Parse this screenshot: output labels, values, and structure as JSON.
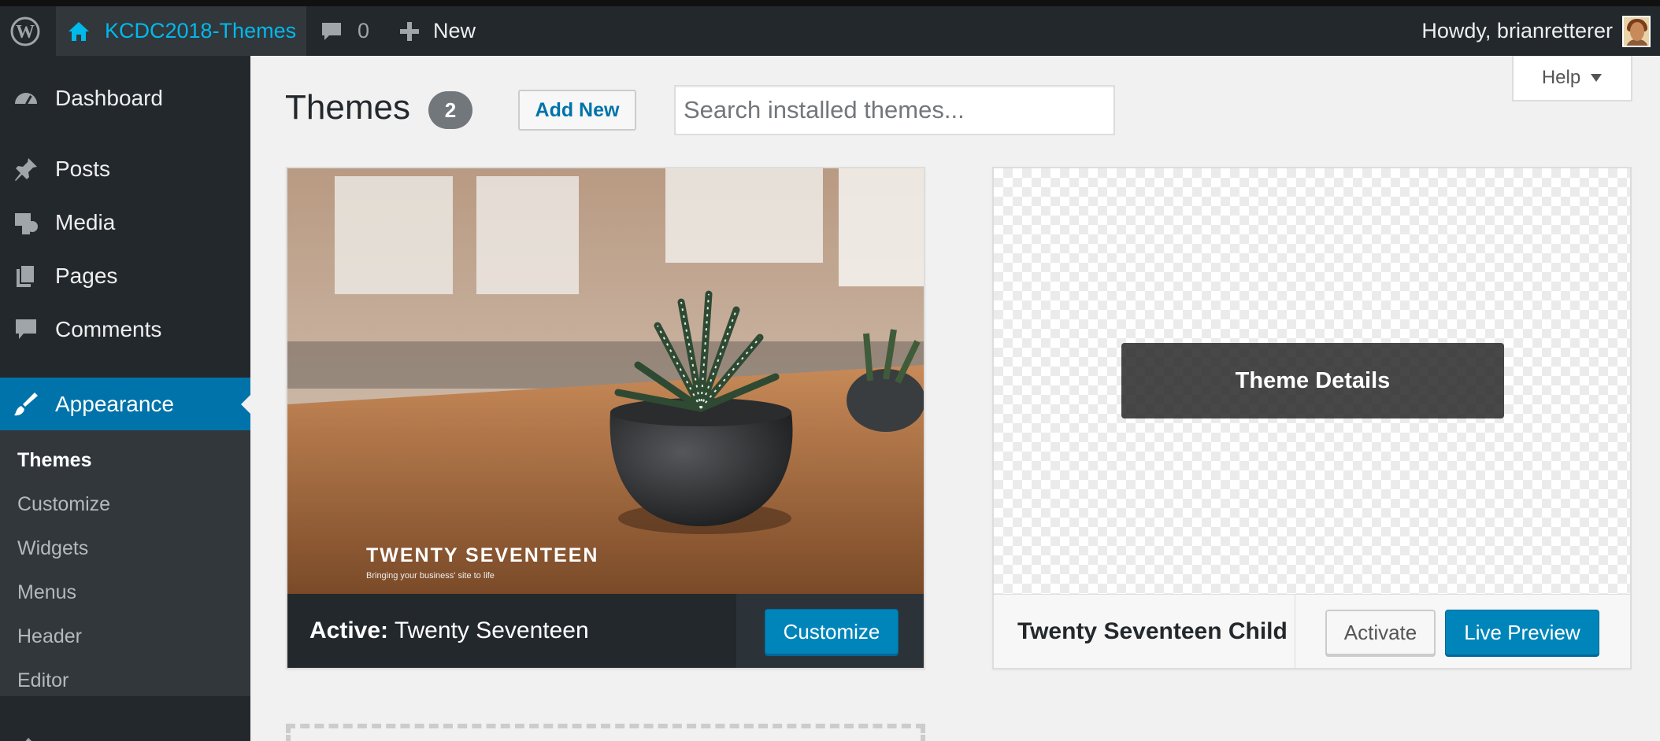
{
  "adminbar": {
    "wp_logo_icon": "wordpress-logo-icon",
    "site_name": "KCDC2018-Themes",
    "site_icon": "home-icon",
    "comments_count": "0",
    "comments_icon": "comment-bubble-icon",
    "new_label": "New",
    "new_icon": "plus-icon",
    "howdy": "Howdy, brianretterer"
  },
  "sidebar": {
    "items": [
      {
        "label": "Dashboard",
        "icon": "dashboard-icon"
      },
      {
        "label": "Posts",
        "icon": "pin-icon"
      },
      {
        "label": "Media",
        "icon": "media-icon"
      },
      {
        "label": "Pages",
        "icon": "pages-icon"
      },
      {
        "label": "Comments",
        "icon": "comment-icon"
      },
      {
        "label": "Appearance",
        "icon": "paintbrush-icon",
        "current": true
      }
    ],
    "submenu": [
      "Themes",
      "Customize",
      "Widgets",
      "Menus",
      "Header",
      "Editor"
    ],
    "accent_color": "#0073aa"
  },
  "main": {
    "title": "Themes",
    "count": "2",
    "add_new": "Add New",
    "search_placeholder": "Search installed themes...",
    "help": "Help"
  },
  "themes": [
    {
      "screenshot_title": "TWENTY SEVENTEEN",
      "screenshot_tagline": "Bringing your business' site to life",
      "active_label": "Active:",
      "name": "Twenty Seventeen",
      "primary_action": "Customize"
    },
    {
      "overlay": "Theme Details",
      "name": "Twenty Seventeen Child",
      "secondary_action": "Activate",
      "primary_action": "Live Preview"
    }
  ]
}
